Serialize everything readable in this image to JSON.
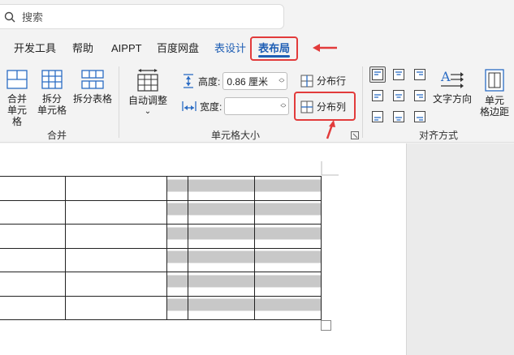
{
  "search": {
    "placeholder": "搜索",
    "icon": "search-icon"
  },
  "tabs": [
    {
      "label": "开发工具"
    },
    {
      "label": "帮助"
    },
    {
      "label": "AIPPT"
    },
    {
      "label": "百度网盘"
    },
    {
      "label": "表设计"
    },
    {
      "label": "表布局",
      "active": true
    }
  ],
  "ribbon": {
    "merge_group": {
      "label": "合并",
      "buttons": [
        {
          "line1": "合并",
          "line2": "单元格",
          "icon": "merge-cells-icon"
        },
        {
          "line1": "拆分",
          "line2": "单元格",
          "icon": "split-cells-icon"
        },
        {
          "line1": "拆分表格",
          "line2": "",
          "icon": "split-table-icon"
        }
      ]
    },
    "cell_size_group": {
      "label": "单元格大小",
      "autofit": {
        "line1": "自动调整",
        "line2": "⌄",
        "icon": "autofit-icon"
      },
      "height": {
        "label": "高度:",
        "value": "0.86 厘米",
        "icon": "height-icon"
      },
      "width": {
        "label": "宽度:",
        "value": "",
        "icon": "width-icon"
      },
      "distribute_rows": {
        "label": "分布行",
        "icon": "distribute-rows-icon"
      },
      "distribute_columns": {
        "label": "分布列",
        "icon": "distribute-columns-icon"
      },
      "launcher_icon": "dialog-launcher-icon"
    },
    "alignment_group": {
      "label": "对齐方式",
      "text_direction": {
        "label": "文字方向",
        "icon": "text-direction-icon"
      },
      "cell_margins": {
        "line1": "单元",
        "line2": "格边距",
        "icon": "cell-margins-icon"
      }
    }
  },
  "colors": {
    "accent": "#1e5eb4",
    "highlight": "#e23b3b",
    "shade": "#c8c8c8"
  },
  "table": {
    "rows": 6,
    "columns": 5
  }
}
